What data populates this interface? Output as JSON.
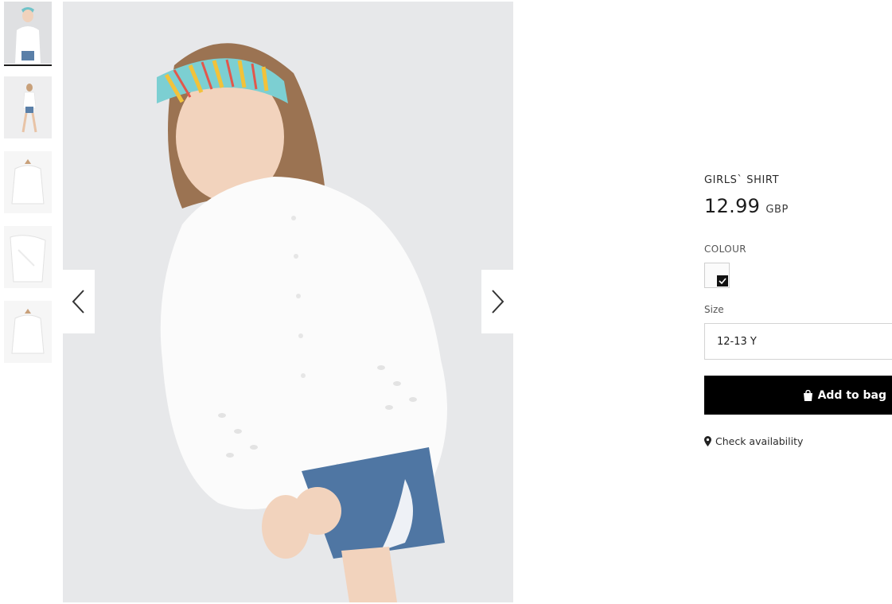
{
  "gallery": {
    "thumbnails": [
      {
        "name": "thumbnail-1",
        "active": true
      },
      {
        "name": "thumbnail-2",
        "active": false
      },
      {
        "name": "thumbnail-3",
        "active": false
      },
      {
        "name": "thumbnail-4",
        "active": false
      },
      {
        "name": "thumbnail-5",
        "active": false
      }
    ],
    "prev_icon": "chevron-left-icon",
    "next_icon": "chevron-right-icon"
  },
  "product": {
    "title": "GIRLS` SHIRT",
    "price": "12.99",
    "currency": "GBP",
    "colour_label": "COLOUR",
    "colour_swatch": {
      "color": "#fbfbfb",
      "selected": true,
      "icon": "checkmark-icon"
    },
    "size_label": "Size",
    "size_value": "12-13 Y",
    "add_to_bag_label": "Add to bag",
    "add_to_bag_icon": "shopping-bag-icon",
    "check_availability_label": "Check availability",
    "check_availability_icon": "location-pin-icon"
  },
  "colors": {
    "button_bg": "#000000",
    "button_text": "#ffffff",
    "image_bg": "#e7e8ea",
    "text": "#1c1c1c"
  }
}
